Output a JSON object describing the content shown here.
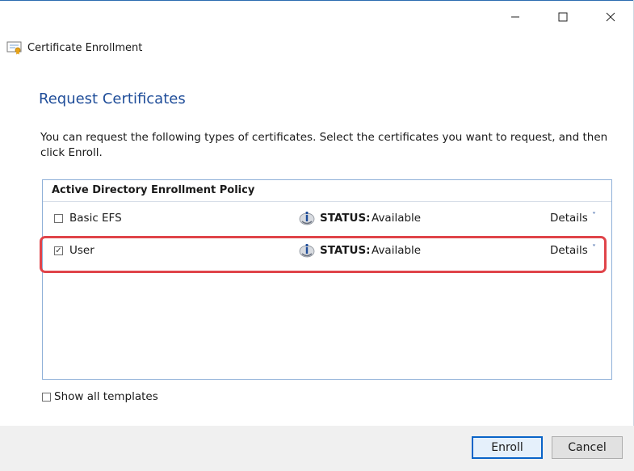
{
  "window": {
    "app_title": "Certificate Enrollment",
    "controls": [
      "minimize",
      "maximize",
      "close"
    ]
  },
  "page": {
    "heading": "Request Certificates",
    "description": "You can request the following types of certificates. Select the certificates you want to request, and then click Enroll."
  },
  "policy": {
    "title": "Active Directory Enrollment Policy",
    "certificates": [
      {
        "name": "Basic EFS",
        "checked": false,
        "status_label": "STATUS:",
        "status": "Available",
        "details_label": "Details",
        "chevron": "˅"
      },
      {
        "name": "User",
        "checked": true,
        "status_label": "STATUS:",
        "status": "Available",
        "details_label": "Details",
        "chevron": "˅"
      }
    ]
  },
  "options": {
    "show_all_templates_label": "Show all templates",
    "show_all_templates_checked": false
  },
  "buttons": {
    "enroll": "Enroll",
    "cancel": "Cancel"
  },
  "colors": {
    "heading": "#1f4d99",
    "highlight": "#e0444a",
    "policy_border": "#8fb0d8",
    "primary_button_border": "#0a64c8"
  },
  "icons": [
    "certificate-icon",
    "info-icon",
    "minimize-icon",
    "maximize-icon",
    "close-icon"
  ]
}
